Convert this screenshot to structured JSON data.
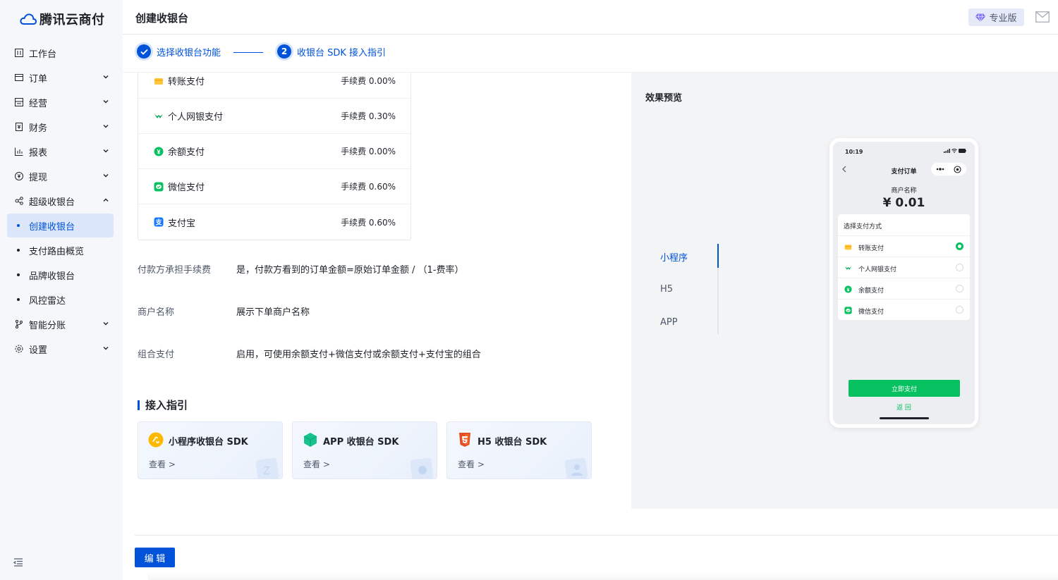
{
  "app": {
    "name": "腾讯云商付"
  },
  "sidebar": {
    "items": [
      {
        "label": "工作台",
        "icon": "dashboard-icon"
      },
      {
        "label": "订单",
        "icon": "order-icon"
      },
      {
        "label": "经营",
        "icon": "store-icon"
      },
      {
        "label": "财务",
        "icon": "finance-icon"
      },
      {
        "label": "报表",
        "icon": "chart-icon"
      },
      {
        "label": "提现",
        "icon": "withdraw-icon"
      },
      {
        "label": "超级收银台",
        "icon": "cashier-icon"
      },
      {
        "label": "创建收银台"
      },
      {
        "label": "支付路由概览"
      },
      {
        "label": "品牌收银台"
      },
      {
        "label": "风控雷达"
      },
      {
        "label": "智能分账",
        "icon": "split-icon"
      },
      {
        "label": "设置",
        "icon": "settings-icon"
      }
    ]
  },
  "header": {
    "title": "创建收银台",
    "badge": "专业版"
  },
  "steps": [
    {
      "label": "选择收银台功能",
      "index": "1",
      "state": "done"
    },
    {
      "label": "收银台 SDK 接入指引",
      "index": "2",
      "state": "active"
    }
  ],
  "payments": [
    {
      "name": "转账支付",
      "fee": "手续费 0.00%"
    },
    {
      "name": "个人网银支付",
      "fee": "手续费 0.30%"
    },
    {
      "name": "余额支付",
      "fee": "手续费 0.00%"
    },
    {
      "name": "微信支付",
      "fee": "手续费 0.60%"
    },
    {
      "name": "支付宝",
      "fee": "手续费 0.60%"
    }
  ],
  "info": [
    {
      "label": "付款方承担手续费",
      "value": "是，付款方看到的订单金额=原始订单金额 / （1-费率）"
    },
    {
      "label": "商户名称",
      "value": "展示下单商户名称"
    },
    {
      "label": "组合支付",
      "value": "启用，可使用余额支付+微信支付或余额支付+支付宝的组合"
    }
  ],
  "guide": {
    "title": "接入指引",
    "cards": [
      {
        "title": "小程序收银台 SDK",
        "link": "查看  >"
      },
      {
        "title": "APP 收银台 SDK",
        "link": "查看  >"
      },
      {
        "title": "H5 收银台 SDK",
        "link": "查看  >"
      }
    ]
  },
  "footer": {
    "edit_label": "编 辑"
  },
  "preview": {
    "title": "效果预览",
    "tabs": [
      "小程序",
      "H5",
      "APP"
    ],
    "active_tab": "小程序",
    "phone": {
      "time": "10:19",
      "title": "支付订单",
      "merchant": "商户名称",
      "amount": "¥ 0.01",
      "section": "选择支付方式",
      "methods": [
        "转账支付",
        "个人网银支付",
        "余额支付",
        "微信支付"
      ],
      "selected": "转账支付",
      "pay_button": "立即支付",
      "return": "返 回"
    }
  },
  "colors": {
    "primary": "#0052d9",
    "wechat_green": "#07c160",
    "sidebar_bg": "#f5f7fb"
  }
}
